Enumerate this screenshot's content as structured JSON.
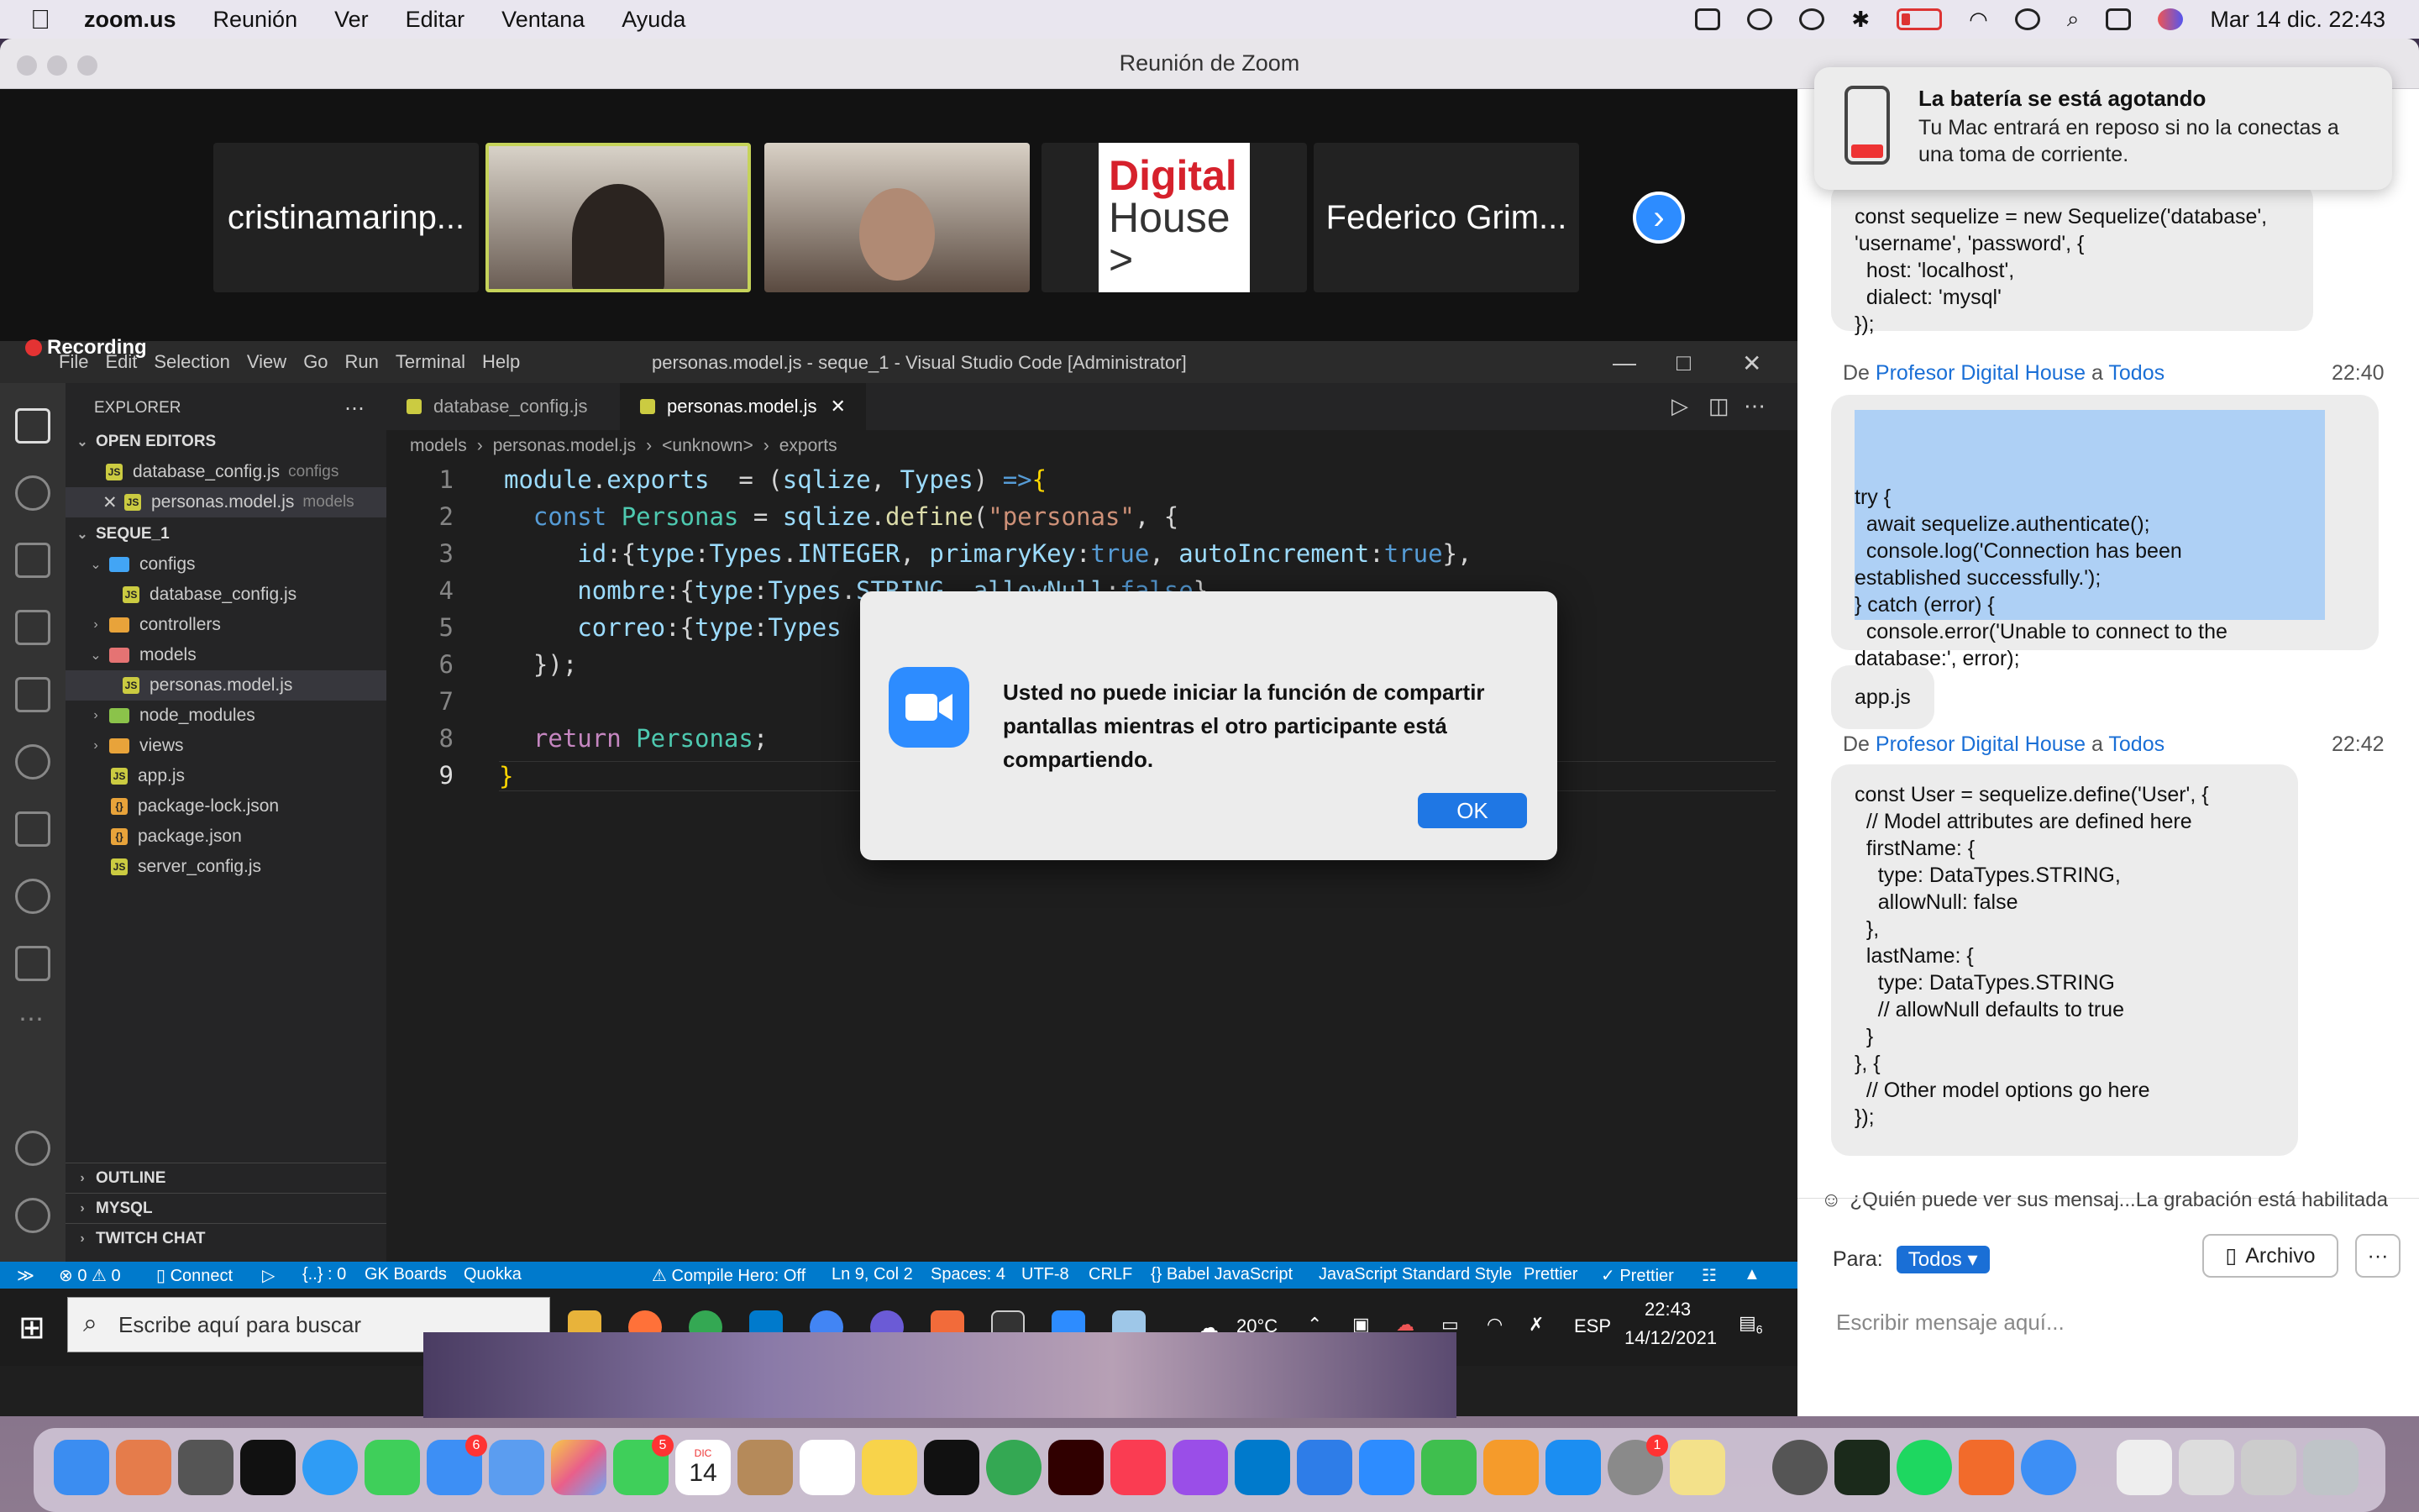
{
  "menubar": {
    "app": "zoom.us",
    "items": [
      "Reunión",
      "Ver",
      "Editar",
      "Ventana",
      "Ayuda"
    ],
    "datetime": "Mar 14 dic.  22:43"
  },
  "zoom": {
    "window_title": "Reunión de Zoom",
    "participants": [
      {
        "name": "cristinamarinp..."
      },
      {
        "name": ""
      },
      {
        "name": ""
      },
      {
        "name": ""
      },
      {
        "name": "Federico Grim..."
      }
    ],
    "dh_logo": [
      "Digital",
      "House >"
    ]
  },
  "recording_label": "Recording",
  "vscode": {
    "menu": [
      "File",
      "Edit",
      "Selection",
      "View",
      "Go",
      "Run",
      "Terminal",
      "Help"
    ],
    "title": "personas.model.js - seque_1 - Visual Studio Code [Administrator]",
    "explorer_label": "EXPLORER",
    "open_editors_label": "OPEN EDITORS",
    "open_editors": [
      {
        "name": "database_config.js",
        "dir": "configs"
      },
      {
        "name": "personas.model.js",
        "dir": "models"
      }
    ],
    "project": "SEQUE_1",
    "tree": [
      {
        "name": "configs",
        "kind": "folder-open"
      },
      {
        "name": "database_config.js",
        "kind": "file"
      },
      {
        "name": "controllers",
        "kind": "folder"
      },
      {
        "name": "models",
        "kind": "folder-open"
      },
      {
        "name": "personas.model.js",
        "kind": "file-selected"
      },
      {
        "name": "node_modules",
        "kind": "folder"
      },
      {
        "name": "views",
        "kind": "folder"
      },
      {
        "name": "app.js",
        "kind": "file"
      },
      {
        "name": "package-lock.json",
        "kind": "file"
      },
      {
        "name": "package.json",
        "kind": "file"
      },
      {
        "name": "server_config.js",
        "kind": "file"
      }
    ],
    "outline_label": "OUTLINE",
    "mysql_label": "MYSQL",
    "twitch_label": "TWITCH CHAT",
    "tabs": [
      "database_config.js",
      "personas.model.js"
    ],
    "breadcrumb": [
      "models",
      "personas.model.js",
      "<unknown>",
      "exports"
    ],
    "line_numbers": [
      "1",
      "2",
      "3",
      "4",
      "5",
      "6",
      "7",
      "8",
      "9"
    ],
    "status": {
      "errors": "0",
      "warnings": "0",
      "connect": "Connect",
      "braces": "{..} : 0",
      "gk": "GK Boards",
      "quokka": "Quokka",
      "compile_hero": "Compile Hero: Off",
      "position": "Ln 9, Col 2",
      "spaces": "Spaces: 4",
      "encoding": "UTF-8",
      "eol": "CRLF",
      "language": "Babel JavaScript",
      "style": "JavaScript Standard Style",
      "prettier1": "Prettier",
      "prettier2": "Prettier"
    }
  },
  "taskbar": {
    "search_placeholder": "Escribe aquí para buscar",
    "temp": "20°C",
    "lang": "ESP",
    "time": "22:43",
    "date": "14/12/2021",
    "notif_count": "6"
  },
  "dialog": {
    "message": "Usted no puede iniciar la función de compartir pantallas mientras el otro participante está compartiendo.",
    "ok": "OK"
  },
  "notification": {
    "title": "La batería se está agotando",
    "body": "Tu Mac entrará en reposo si no la conectas a una toma de corriente."
  },
  "chat": {
    "msg1": "const sequelize = new Sequelize('database',\n'username', 'password', {\n  host: 'localhost',\n  dialect: 'mysql'\n});",
    "sender_prefix": "De",
    "sender": "Profesor Digital House",
    "to_word": "a",
    "to": "Todos",
    "time2": "22:40",
    "msg2": "try {\n  await sequelize.authenticate();\n  console.log('Connection has been\nestablished successfully.');\n} catch (error) {\n  console.error('Unable to connect to the\ndatabase:', error);\n}",
    "msg3": "app.js",
    "time4": "22:42",
    "msg4": "const User = sequelize.define('User', {\n  // Model attributes are defined here\n  firstName: {\n    type: DataTypes.STRING,\n    allowNull: false\n  },\n  lastName: {\n    type: DataTypes.STRING\n    // allowNull defaults to true\n  }\n}, {\n  // Other model options go here\n});",
    "privacy": "¿Quién puede ver sus mensaj...La grabación está habilitada",
    "to_label": "Para:",
    "to_value": "Todos",
    "file_btn": "Archivo",
    "more_btn": "···",
    "input_placeholder": "Escribir mensaje aquí..."
  },
  "dock": {
    "badges": {
      "mail": "6",
      "facetime": "5",
      "calendar_day": "14",
      "calendar_month": "DIC",
      "prefs": "1"
    }
  }
}
